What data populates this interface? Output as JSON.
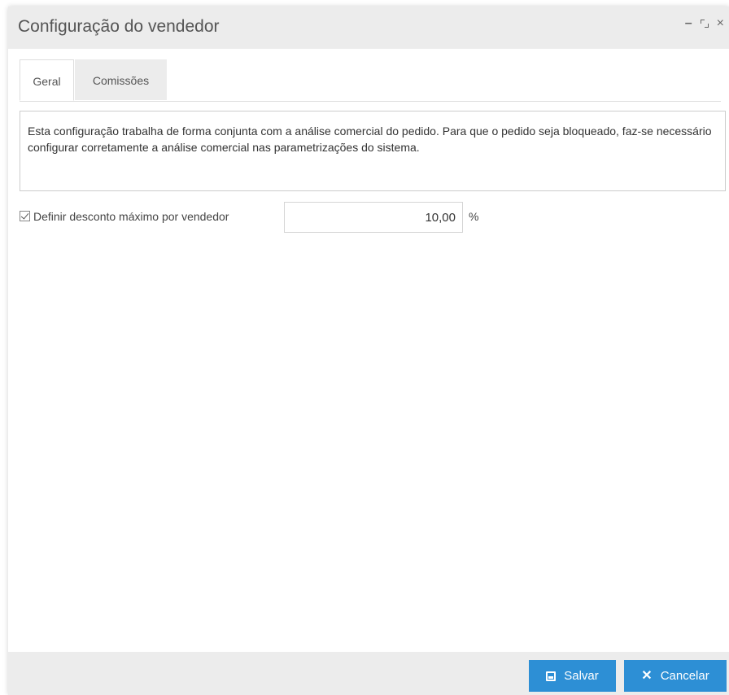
{
  "window": {
    "title": "Configuração do vendedor",
    "controls": {
      "minimize": "–",
      "close": "×"
    }
  },
  "tabs": [
    {
      "label": "Geral",
      "active": true
    },
    {
      "label": "Comissões",
      "active": false
    }
  ],
  "info": {
    "text": "Esta configuração trabalha de forma conjunta com a análise comercial do pedido. Para que o pedido seja bloqueado, faz-se necessário configurar corretamente a análise comercial nas parametrizações do sistema."
  },
  "discount": {
    "checked": true,
    "label": "Definir desconto máximo por vendedor",
    "value": "10,00",
    "unit": "%"
  },
  "footer": {
    "save_label": "Salvar",
    "cancel_label": "Cancelar",
    "save_icon": "floppy-disk-icon",
    "cancel_icon": "close-icon"
  },
  "colors": {
    "accent": "#2d8fd5",
    "titlebar": "#ececec"
  }
}
